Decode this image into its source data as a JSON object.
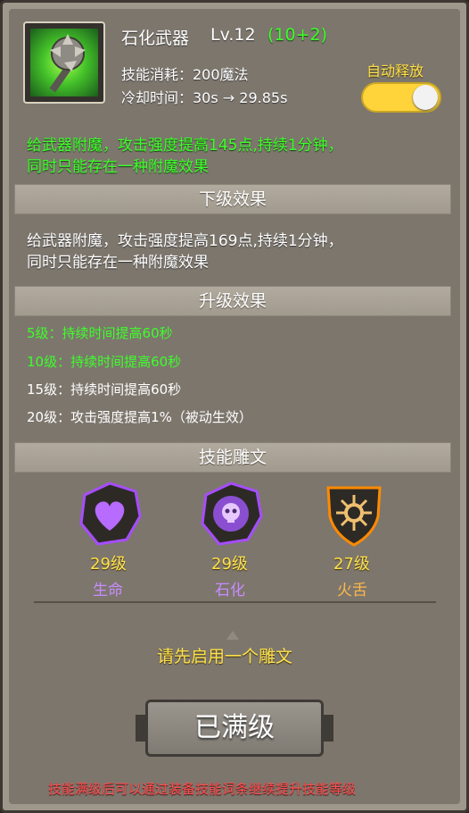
{
  "skill": {
    "name": "石化武器",
    "level": "Lv.12",
    "level_bonus": "(10+2)",
    "cost": "技能消耗：200魔法",
    "cooldown": "冷却时间：30s → 29.85s",
    "auto_release_label": "自动释放",
    "auto_release_on": true,
    "current_effect_line1": "给武器附魔，攻击强度提高145点,持续1分钟，",
    "current_effect_line2": "同时只能存在一种附魔效果"
  },
  "sections": {
    "next_level_title": "下级效果",
    "next_level_line1": "给武器附魔，攻击强度提高169点,持续1分钟，",
    "next_level_line2": "同时只能存在一种附魔效果",
    "upgrade_title": "升级效果",
    "upgrades": [
      {
        "text": "5级：持续时间提高60秒",
        "color": "#3dff2a"
      },
      {
        "text": "10级：持续时间提高60秒",
        "color": "#3dff2a"
      },
      {
        "text": "15级：持续时间提高60秒",
        "color": "#ffffff"
      },
      {
        "text": "20级：攻击强度提高1%（被动生效）",
        "color": "#ffffff"
      }
    ],
    "rune_title": "技能雕文"
  },
  "runes": [
    {
      "level": "29级",
      "name": "生命",
      "icon": "heart-icon",
      "color": "#a64dff"
    },
    {
      "level": "29级",
      "name": "石化",
      "icon": "skull-icon",
      "color": "#a64dff"
    },
    {
      "level": "27级",
      "name": "火舌",
      "icon": "fire-burst-icon",
      "color": "#ff8a00"
    }
  ],
  "hint": "请先启用一个雕文",
  "max_button": "已满级",
  "footer_note": "技能满级后可以通过装备技能词条继续提升技能等级"
}
